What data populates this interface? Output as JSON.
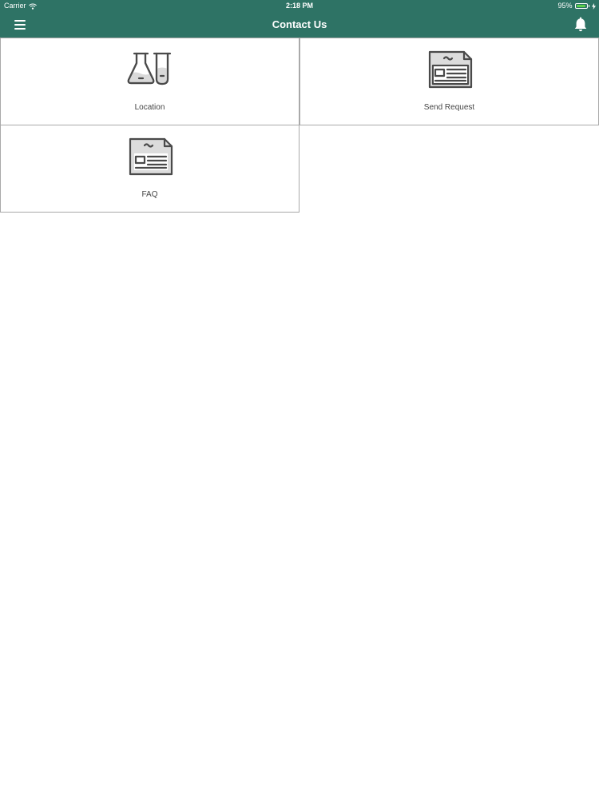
{
  "status_bar": {
    "carrier": "Carrier",
    "time": "2:18 PM",
    "battery_percent": "95%",
    "battery_level": 0.95,
    "wifi_icon": "wifi-icon",
    "charging_icon": "bolt-icon"
  },
  "header": {
    "title": "Contact Us",
    "menu_icon": "hamburger-menu-icon",
    "notification_icon": "bell-icon",
    "background_color": "#2e7365"
  },
  "tiles": [
    {
      "label": "Location",
      "icon": "lab-flask-icon"
    },
    {
      "label": "Send Request",
      "icon": "newspaper-icon"
    },
    {
      "label": "FAQ",
      "icon": "newspaper-icon"
    }
  ],
  "colors": {
    "battery_fill": "#5ccf4c",
    "tile_border": "#a9a9a9",
    "icon_stroke": "#4a4a4a"
  }
}
